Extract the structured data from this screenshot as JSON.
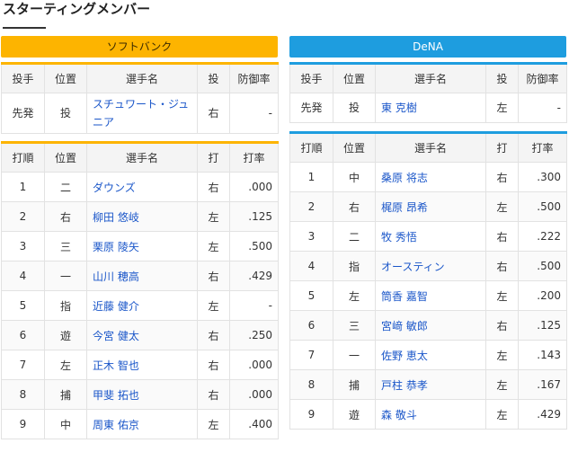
{
  "title": "スターティングメンバー",
  "pitcher_headers": [
    "投手",
    "位置",
    "選手名",
    "投",
    "防御率"
  ],
  "batter_headers": [
    "打順",
    "位置",
    "選手名",
    "打",
    "打率"
  ],
  "teams": [
    {
      "name": "ソフトバンク",
      "color": "#fdb400",
      "pitcher": {
        "role": "先発",
        "pos": "投",
        "name": "スチュワート・ジュニア",
        "hand": "右",
        "era": "-"
      },
      "batters": [
        {
          "order": "1",
          "pos": "二",
          "name": "ダウンズ",
          "hand": "右",
          "avg": ".000"
        },
        {
          "order": "2",
          "pos": "右",
          "name": "柳田 悠岐",
          "hand": "左",
          "avg": ".125"
        },
        {
          "order": "3",
          "pos": "三",
          "name": "栗原 陵矢",
          "hand": "左",
          "avg": ".500"
        },
        {
          "order": "4",
          "pos": "一",
          "name": "山川 穂高",
          "hand": "右",
          "avg": ".429"
        },
        {
          "order": "5",
          "pos": "指",
          "name": "近藤 健介",
          "hand": "左",
          "avg": "-"
        },
        {
          "order": "6",
          "pos": "遊",
          "name": "今宮 健太",
          "hand": "右",
          "avg": ".250"
        },
        {
          "order": "7",
          "pos": "左",
          "name": "正木 智也",
          "hand": "右",
          "avg": ".000"
        },
        {
          "order": "8",
          "pos": "捕",
          "name": "甲斐 拓也",
          "hand": "右",
          "avg": ".000"
        },
        {
          "order": "9",
          "pos": "中",
          "name": "周東 佑京",
          "hand": "左",
          "avg": ".400"
        }
      ]
    },
    {
      "name": "DeNA",
      "color": "#1e9ddf",
      "pitcher": {
        "role": "先発",
        "pos": "投",
        "name": "東 克樹",
        "hand": "左",
        "era": "-"
      },
      "batters": [
        {
          "order": "1",
          "pos": "中",
          "name": "桑原 将志",
          "hand": "右",
          "avg": ".300"
        },
        {
          "order": "2",
          "pos": "右",
          "name": "梶原 昂希",
          "hand": "左",
          "avg": ".500"
        },
        {
          "order": "3",
          "pos": "二",
          "name": "牧 秀悟",
          "hand": "右",
          "avg": ".222"
        },
        {
          "order": "4",
          "pos": "指",
          "name": "オースティン",
          "hand": "右",
          "avg": ".500"
        },
        {
          "order": "5",
          "pos": "左",
          "name": "筒香 嘉智",
          "hand": "左",
          "avg": ".200"
        },
        {
          "order": "6",
          "pos": "三",
          "name": "宮﨑 敏郎",
          "hand": "右",
          "avg": ".125"
        },
        {
          "order": "7",
          "pos": "一",
          "name": "佐野 恵太",
          "hand": "左",
          "avg": ".143"
        },
        {
          "order": "8",
          "pos": "捕",
          "name": "戸柱 恭孝",
          "hand": "左",
          "avg": ".167"
        },
        {
          "order": "9",
          "pos": "遊",
          "name": "森 敬斗",
          "hand": "左",
          "avg": ".429"
        }
      ]
    }
  ]
}
